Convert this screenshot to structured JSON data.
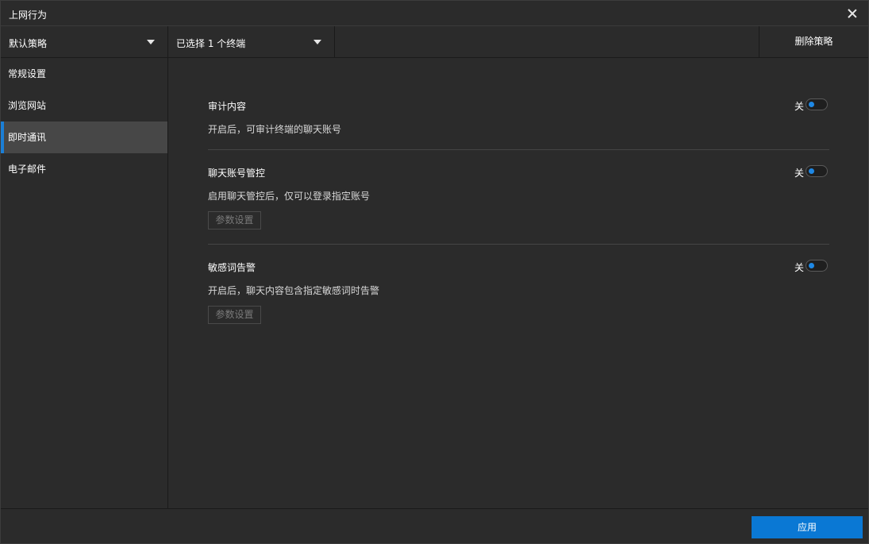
{
  "window": {
    "title": "上网行为"
  },
  "toolbar": {
    "policy_label": "默认策略",
    "terminal_label": "已选择 1 个终端",
    "delete_label": "删除策略"
  },
  "sidebar": {
    "items": [
      {
        "label": "常规设置"
      },
      {
        "label": "浏览网站"
      },
      {
        "label": "即时通讯"
      },
      {
        "label": "电子邮件"
      }
    ]
  },
  "sections": [
    {
      "title": "审计内容",
      "desc": "开启后，可审计终端的聊天账号",
      "toggle": "关"
    },
    {
      "title": "聊天账号管控",
      "desc": "启用聊天管控后，仅可以登录指定账号",
      "toggle": "关",
      "button": "参数设置"
    },
    {
      "title": "敏感词告警",
      "desc": "开启后，聊天内容包含指定敏感词时告警",
      "toggle": "关",
      "button": "参数设置"
    }
  ],
  "footer": {
    "apply_label": "应用"
  },
  "colors": {
    "accent": "#0a78d4",
    "active_indicator": "#1b7fd6",
    "background": "#2b2b2b"
  },
  "icons": {
    "close": "close-icon",
    "dropdown": "chevron-down-icon"
  }
}
